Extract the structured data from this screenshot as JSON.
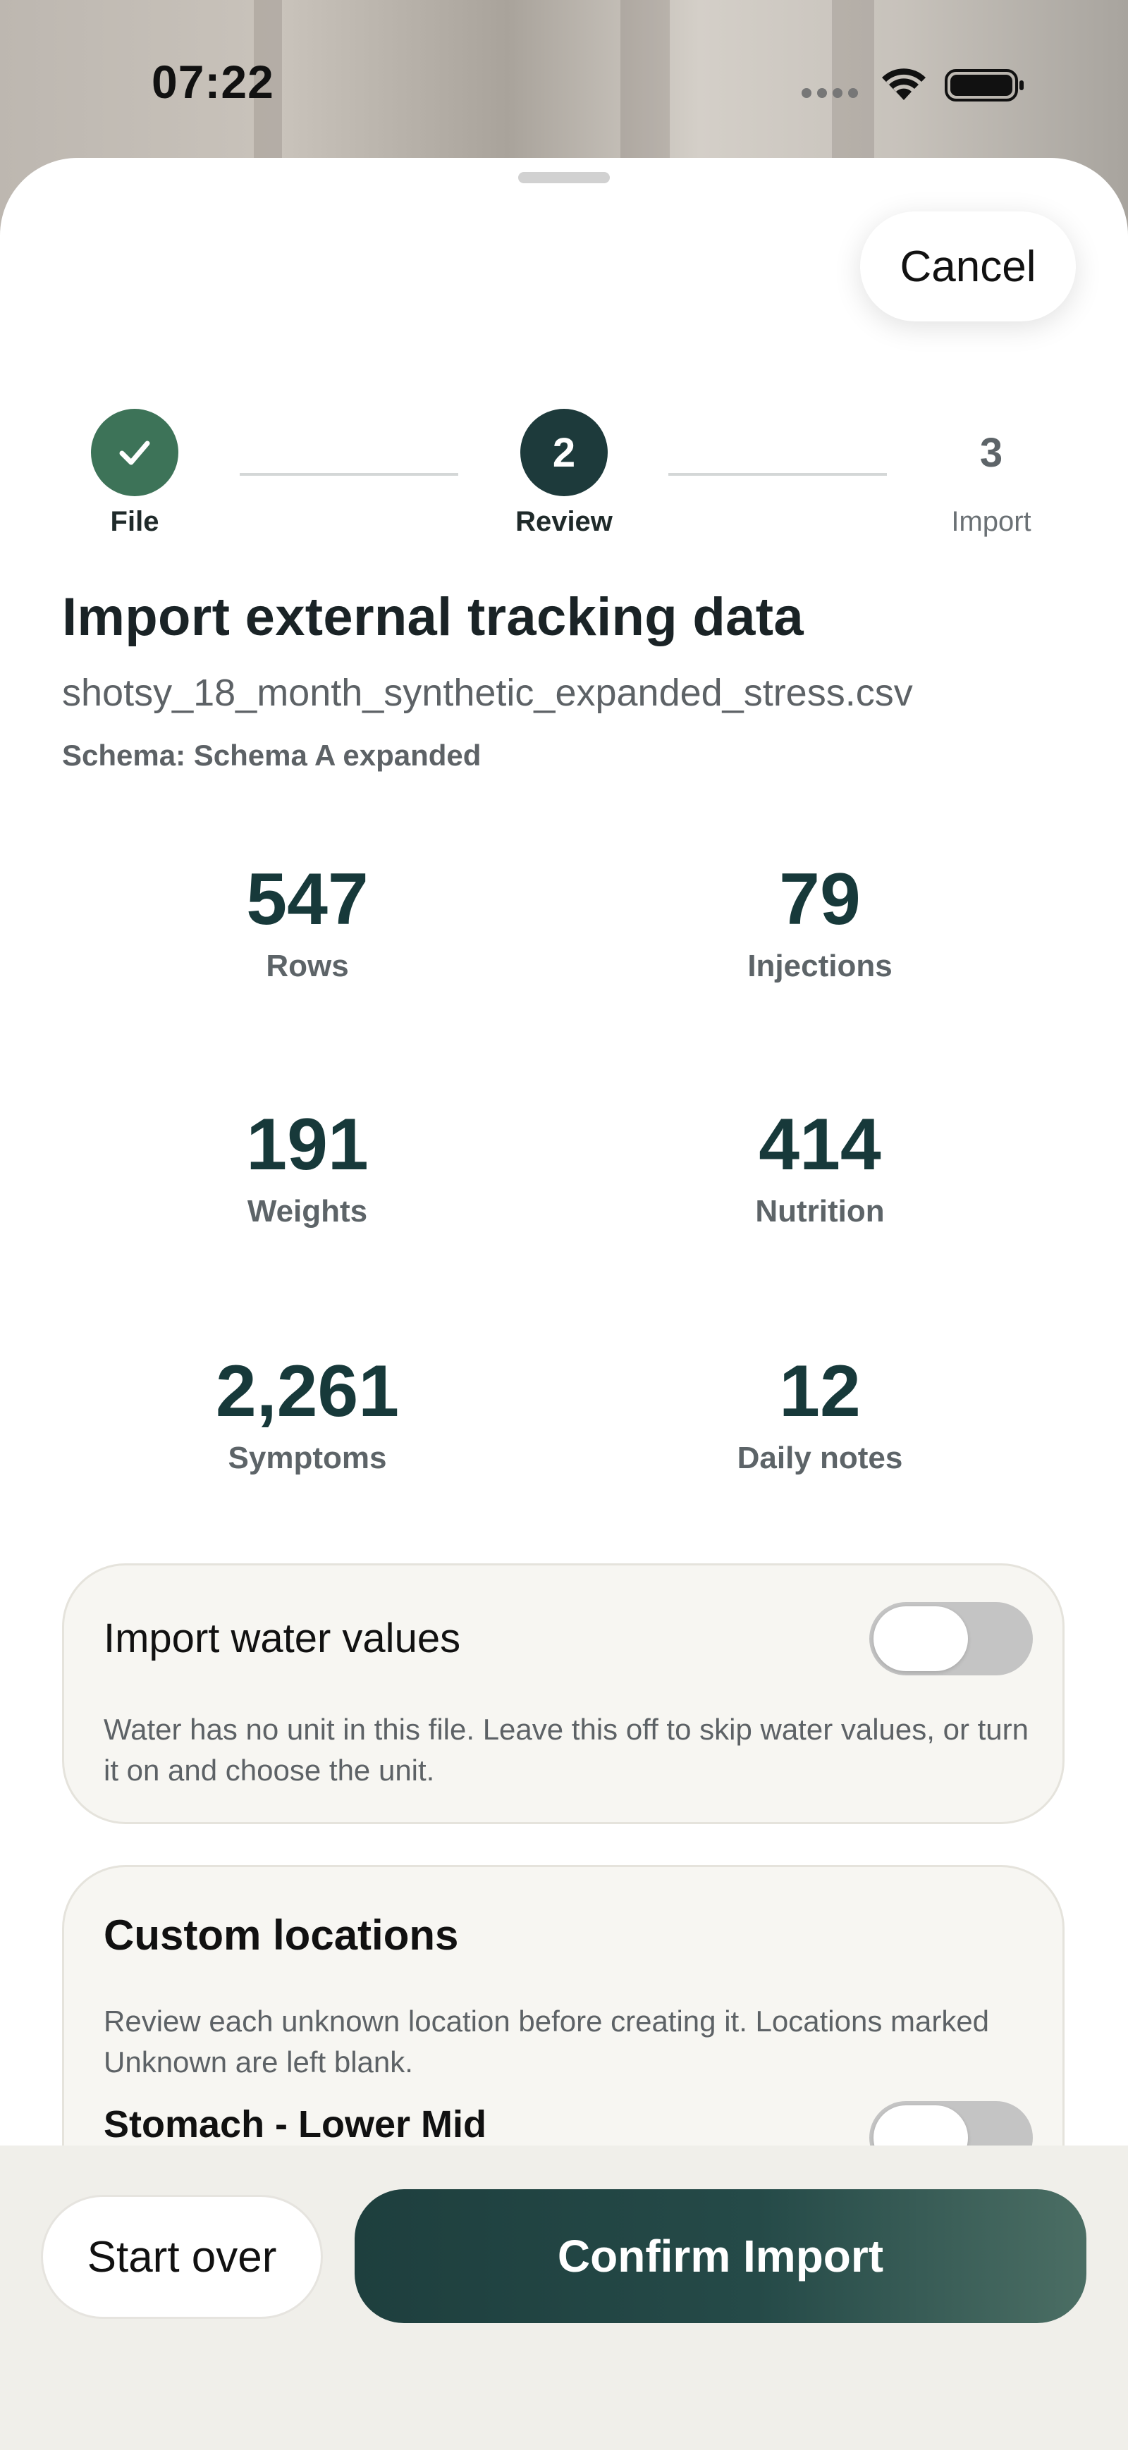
{
  "status_bar": {
    "time": "07:22",
    "icons": [
      "signal-icon",
      "wifi-icon",
      "battery-icon"
    ]
  },
  "sheet": {
    "cancel_label": "Cancel"
  },
  "stepper": {
    "steps": [
      {
        "number": "1",
        "label": "File",
        "state": "done"
      },
      {
        "number": "2",
        "label": "Review",
        "state": "active"
      },
      {
        "number": "3",
        "label": "Import",
        "state": "upcoming"
      }
    ]
  },
  "header": {
    "title": "Import external tracking data",
    "filename": "shotsy_18_month_synthetic_expanded_stress.csv",
    "schema": "Schema: Schema A expanded"
  },
  "stats": [
    {
      "value": "547",
      "label": "Rows"
    },
    {
      "value": "79",
      "label": "Injections"
    },
    {
      "value": "191",
      "label": "Weights"
    },
    {
      "value": "414",
      "label": "Nutrition"
    },
    {
      "value": "2,261",
      "label": "Symptoms"
    },
    {
      "value": "12",
      "label": "Daily notes"
    }
  ],
  "water_card": {
    "title": "Import water values",
    "toggle_on": false,
    "description": "Water has no unit in this file. Leave this off to skip water values, or turn it on and choose the unit."
  },
  "locations_card": {
    "title": "Custom locations",
    "description": "Review each unknown location before creating it. Locations marked Unknown are left blank.",
    "items": [
      {
        "name": "Stomach - Lower Mid",
        "toggle_on": false
      }
    ]
  },
  "footer": {
    "start_over_label": "Start over",
    "confirm_label": "Confirm Import"
  },
  "colors": {
    "accent_dark": "#17393a",
    "done_green": "#3d7358",
    "active_step": "#1d3a3b"
  }
}
